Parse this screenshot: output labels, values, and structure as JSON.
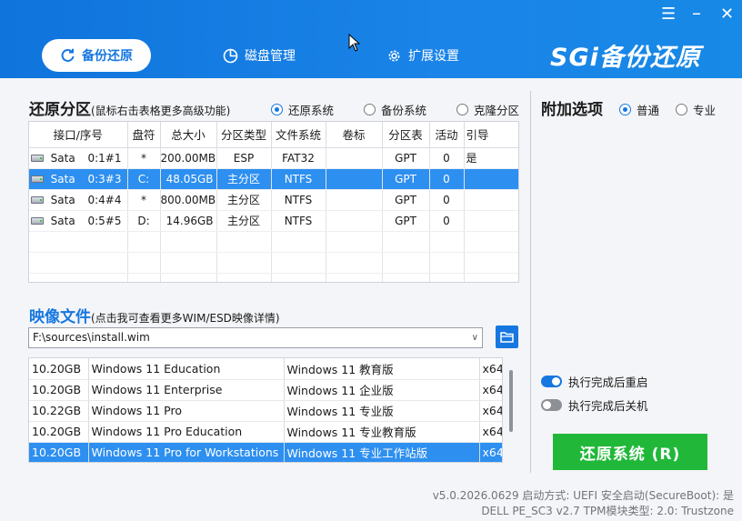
{
  "header": {
    "tabs": [
      {
        "label": "备份还原",
        "active": true
      },
      {
        "label": "磁盘管理",
        "active": false
      },
      {
        "label": "扩展设置",
        "active": false
      }
    ],
    "brand": "SGi备份还原",
    "window_controls": {
      "menu": "☰",
      "close": "✕"
    }
  },
  "restore": {
    "title": "还原分区",
    "hint": "(鼠标右击表格更多高级功能)",
    "modes": [
      {
        "label": "还原系统",
        "selected": true
      },
      {
        "label": "备份系统",
        "selected": false
      },
      {
        "label": "克隆分区",
        "selected": false
      }
    ],
    "columns": [
      "接口/序号",
      "盘符",
      "总大小",
      "分区类型",
      "文件系统",
      "卷标",
      "分区表",
      "活动",
      "引导"
    ],
    "rows": [
      {
        "iface": "Sata",
        "index": "0:1#1",
        "drive": "*",
        "size": "200.00MB",
        "ptype": "ESP",
        "fs": "FAT32",
        "label": "",
        "table": "GPT",
        "active": "0",
        "boot": "是",
        "selected": false
      },
      {
        "iface": "Sata",
        "index": "0:3#3",
        "drive": "C:",
        "size": "48.05GB",
        "ptype": "主分区",
        "fs": "NTFS",
        "label": "",
        "table": "GPT",
        "active": "0",
        "boot": "",
        "selected": true
      },
      {
        "iface": "Sata",
        "index": "0:4#4",
        "drive": "*",
        "size": "800.00MB",
        "ptype": "主分区",
        "fs": "NTFS",
        "label": "",
        "table": "GPT",
        "active": "0",
        "boot": "",
        "selected": false
      },
      {
        "iface": "Sata",
        "index": "0:5#5",
        "drive": "D:",
        "size": "14.96GB",
        "ptype": "主分区",
        "fs": "NTFS",
        "label": "",
        "table": "GPT",
        "active": "0",
        "boot": "",
        "selected": false
      }
    ]
  },
  "image": {
    "title": "映像文件",
    "hint": "(点击我可查看更多WIM/ESD映像详情)",
    "path": "F:\\sources\\install.wim",
    "editions": [
      {
        "size": "10.20GB",
        "name_en": "Windows 11 Education",
        "name_cn": "Windows 11 教育版",
        "arch": "x64",
        "selected": false
      },
      {
        "size": "10.20GB",
        "name_en": "Windows 11 Enterprise",
        "name_cn": "Windows 11 企业版",
        "arch": "x64",
        "selected": false
      },
      {
        "size": "10.22GB",
        "name_en": "Windows 11 Pro",
        "name_cn": "Windows 11 专业版",
        "arch": "x64",
        "selected": false
      },
      {
        "size": "10.20GB",
        "name_en": "Windows 11 Pro Education",
        "name_cn": "Windows 11 专业教育版",
        "arch": "x64",
        "selected": false
      },
      {
        "size": "10.20GB",
        "name_en": "Windows 11 Pro for Workstations",
        "name_cn": "Windows 11 专业工作站版",
        "arch": "x64",
        "selected": true
      }
    ]
  },
  "options": {
    "title": "附加选项",
    "modes": [
      {
        "label": "普通",
        "selected": true
      },
      {
        "label": "专业",
        "selected": false
      }
    ],
    "toggles": [
      {
        "label": "执行完成后重启",
        "on": true
      },
      {
        "label": "执行完成后关机",
        "on": false
      }
    ],
    "action_button": "还原系统 (R)"
  },
  "status": {
    "line1": "v5.0.2026.0629    启动方式:  UEFI    安全启动(SecureBoot): 是",
    "line2": "DELL  PE_SC3  v2.7    TPM模块类型: 2.0: Trustzone"
  },
  "colors": {
    "accent": "#1677e0",
    "selection": "#2d8ff0",
    "action": "#21b83a"
  }
}
